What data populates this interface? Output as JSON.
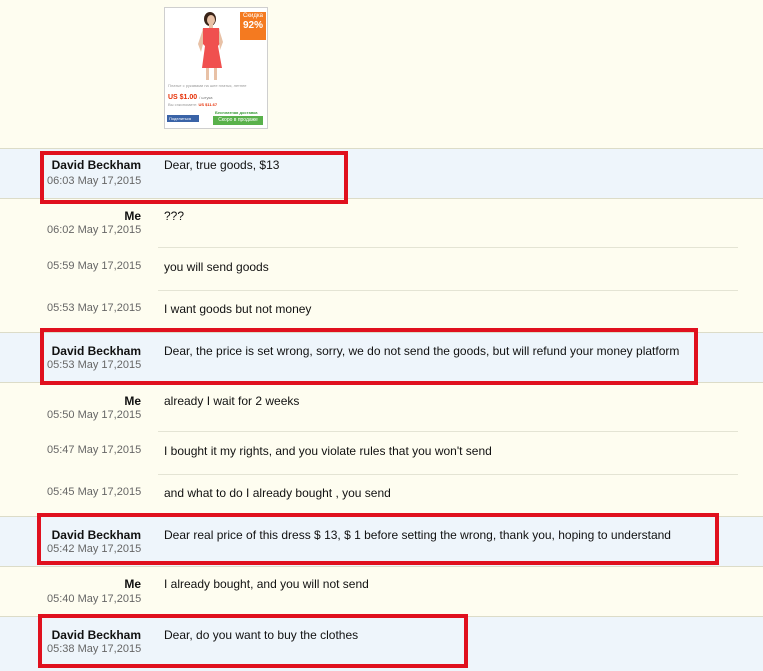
{
  "product": {
    "badge_top": "Скидка",
    "badge_percent": "92%",
    "description": "Платье с рукавами на шее платья, летнее",
    "price": "US $1.00",
    "price_unit": "/ штука",
    "old_price_label": "Вы сэкономите:",
    "old_price": "US $11.67",
    "shipping": "Бесплатная доставка",
    "share_label": "Поделиться",
    "soon_label": "Скоро в продаже"
  },
  "messages": [
    {
      "sender": "David Beckham",
      "time": "06:03 May 17,2015",
      "text": "Dear, true goods, $13",
      "from": "them"
    },
    {
      "sender": "Me",
      "time": "06:02 May 17,2015",
      "text": "???",
      "from": "me"
    },
    {
      "sender": "",
      "time": "05:59 May 17,2015",
      "text": "you will send goods",
      "from": "me"
    },
    {
      "sender": "",
      "time": "05:53 May 17,2015",
      "text": "I want goods but not money",
      "from": "me"
    },
    {
      "sender": "David Beckham",
      "time": "05:53 May 17,2015",
      "text": "Dear, the price is set wrong, sorry, we do not send the goods, but will refund your money platform",
      "from": "them"
    },
    {
      "sender": "Me",
      "time": "05:50 May 17,2015",
      "text": "already I wait for 2 weeks",
      "from": "me"
    },
    {
      "sender": "",
      "time": "05:47 May 17,2015",
      "text": "I bought it my rights, and you violate rules that you won't send",
      "from": "me"
    },
    {
      "sender": "",
      "time": "05:45 May 17,2015",
      "text": "and what to do I already bought , you send",
      "from": "me"
    },
    {
      "sender": "David Beckham",
      "time": "05:42 May 17,2015",
      "text": "Dear real price of this dress $ 13, $ 1 before setting the wrong, thank you, hoping to understand",
      "from": "them"
    },
    {
      "sender": "Me",
      "time": "05:40 May 17,2015",
      "text": "I already bought, and you will not send",
      "from": "me"
    },
    {
      "sender": "David Beckham",
      "time": "05:38 May 17,2015",
      "text": "Dear, do you want to buy the clothes",
      "from": "them"
    }
  ]
}
